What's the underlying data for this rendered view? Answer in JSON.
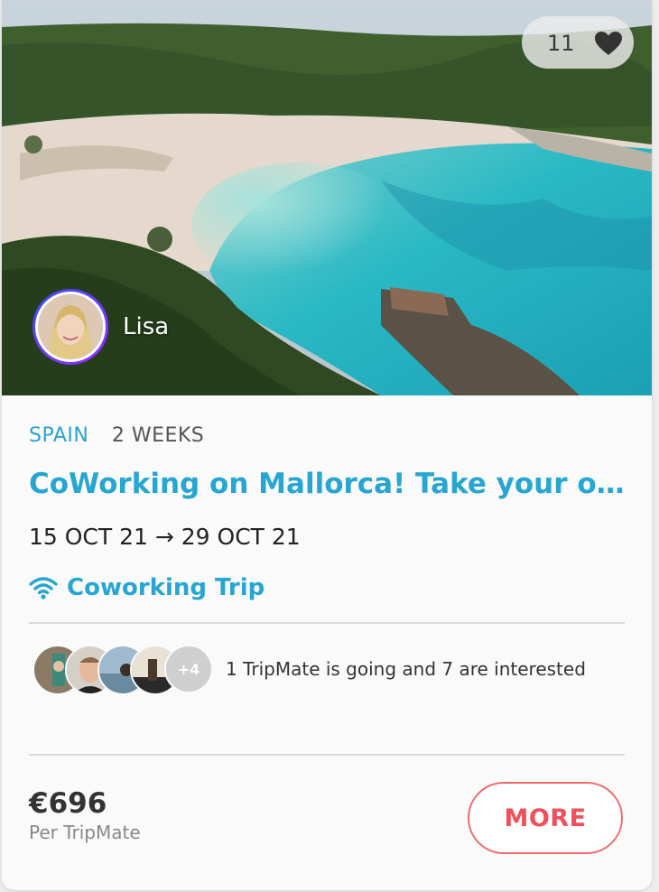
{
  "card": {
    "likes": "11",
    "host_name": "Lisa",
    "country": "SPAIN",
    "duration": "2 WEEKS",
    "title": "CoWorking on Mallorca! Take your office to the beach",
    "dates": "15 OCT 21 → 29 OCT 21",
    "trip_type": "Coworking Trip",
    "mates_summary": "1 TripMate is going and 7 are interested",
    "mates_extra": "+4",
    "price": "€696",
    "price_unit": "Per TripMate",
    "more_label": "MORE"
  },
  "colors": {
    "accent_blue": "#26a6d1",
    "button_red": "#f0505a",
    "avatar_ring": "#7a2bff"
  },
  "icons": {
    "like": "heart-icon",
    "trip_type": "wifi-icon"
  }
}
